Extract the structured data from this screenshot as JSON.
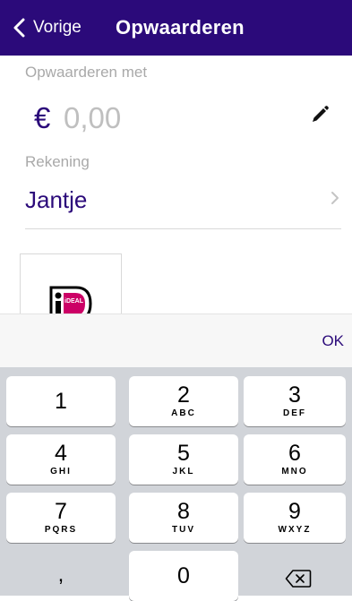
{
  "nav": {
    "back_label": "Vorige",
    "title": "Opwaarderen",
    "background_color": "#2b0a7a"
  },
  "amount": {
    "label": "Opwaarderen met",
    "currency": "€",
    "value": "0,00",
    "edit_icon": "pencil-icon"
  },
  "account": {
    "label": "Rekening",
    "name": "Jantje",
    "chevron_icon": "chevron-right-icon"
  },
  "payment_method": {
    "logo_text": "iDEAL"
  },
  "keyboard": {
    "ok_label": "OK",
    "keys": [
      {
        "digit": "1",
        "letters": ""
      },
      {
        "digit": "2",
        "letters": "ABC"
      },
      {
        "digit": "3",
        "letters": "DEF"
      },
      {
        "digit": "4",
        "letters": "GHI"
      },
      {
        "digit": "5",
        "letters": "JKL"
      },
      {
        "digit": "6",
        "letters": "MNO"
      },
      {
        "digit": "7",
        "letters": "PQRS"
      },
      {
        "digit": "8",
        "letters": "TUV"
      },
      {
        "digit": "9",
        "letters": "WXYZ"
      },
      {
        "digit": ",",
        "letters": ""
      },
      {
        "digit": "0",
        "letters": ""
      }
    ],
    "delete_icon": "backspace-icon"
  }
}
